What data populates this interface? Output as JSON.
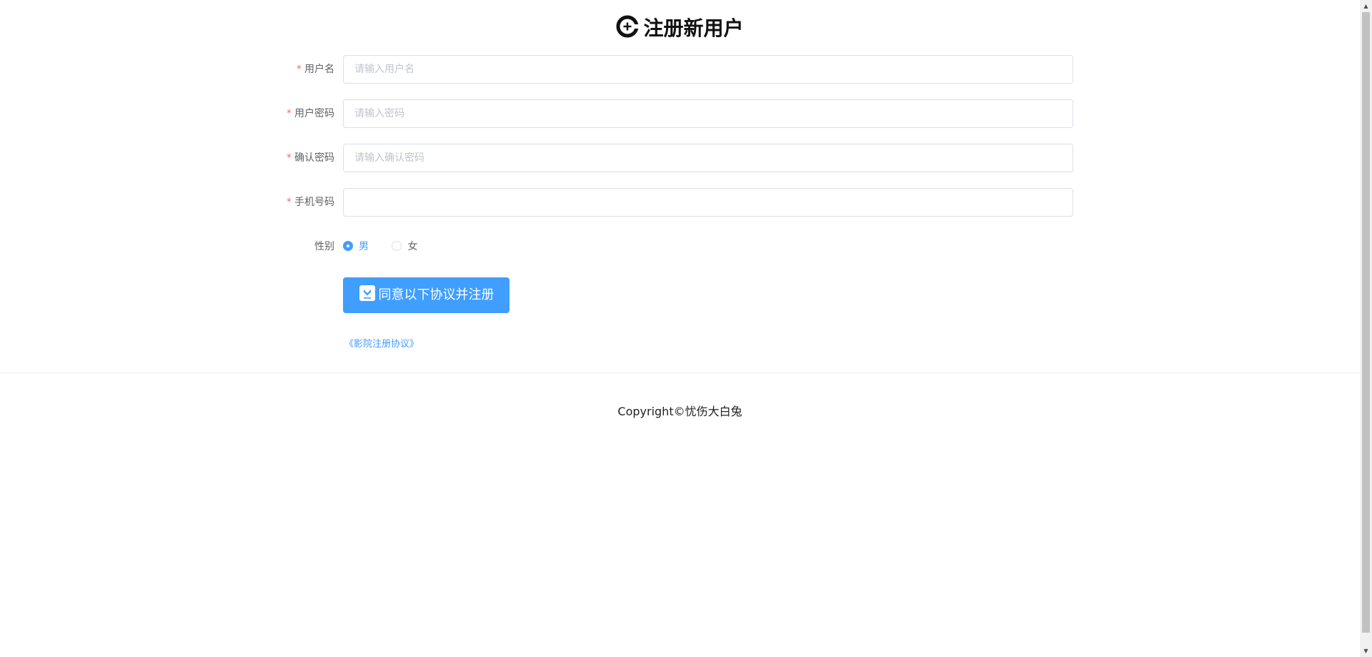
{
  "title": "注册新用户",
  "title_icon": "add-circle-icon",
  "required_mark": "*",
  "fields": {
    "username": {
      "label": "用户名",
      "placeholder": "请输入用户名",
      "value": ""
    },
    "password": {
      "label": "用户密码",
      "placeholder": "请输入密码",
      "value": ""
    },
    "confirm_password": {
      "label": "确认密码",
      "placeholder": "请输入确认密码",
      "value": ""
    },
    "phone": {
      "label": "手机号码",
      "placeholder": "",
      "value": ""
    }
  },
  "gender": {
    "label": "性别",
    "options": [
      "男",
      "女"
    ],
    "selected": "男"
  },
  "submit_button": {
    "label": "同意以下协议并注册",
    "icon": "checkbox-heart-icon"
  },
  "agreement_link": "《影院注册协议》",
  "footer": {
    "copyright": "Copyright©忧伤大白兔"
  },
  "colors": {
    "primary": "#409eff",
    "required": "#f56c6c",
    "border": "#dcdfe6"
  }
}
